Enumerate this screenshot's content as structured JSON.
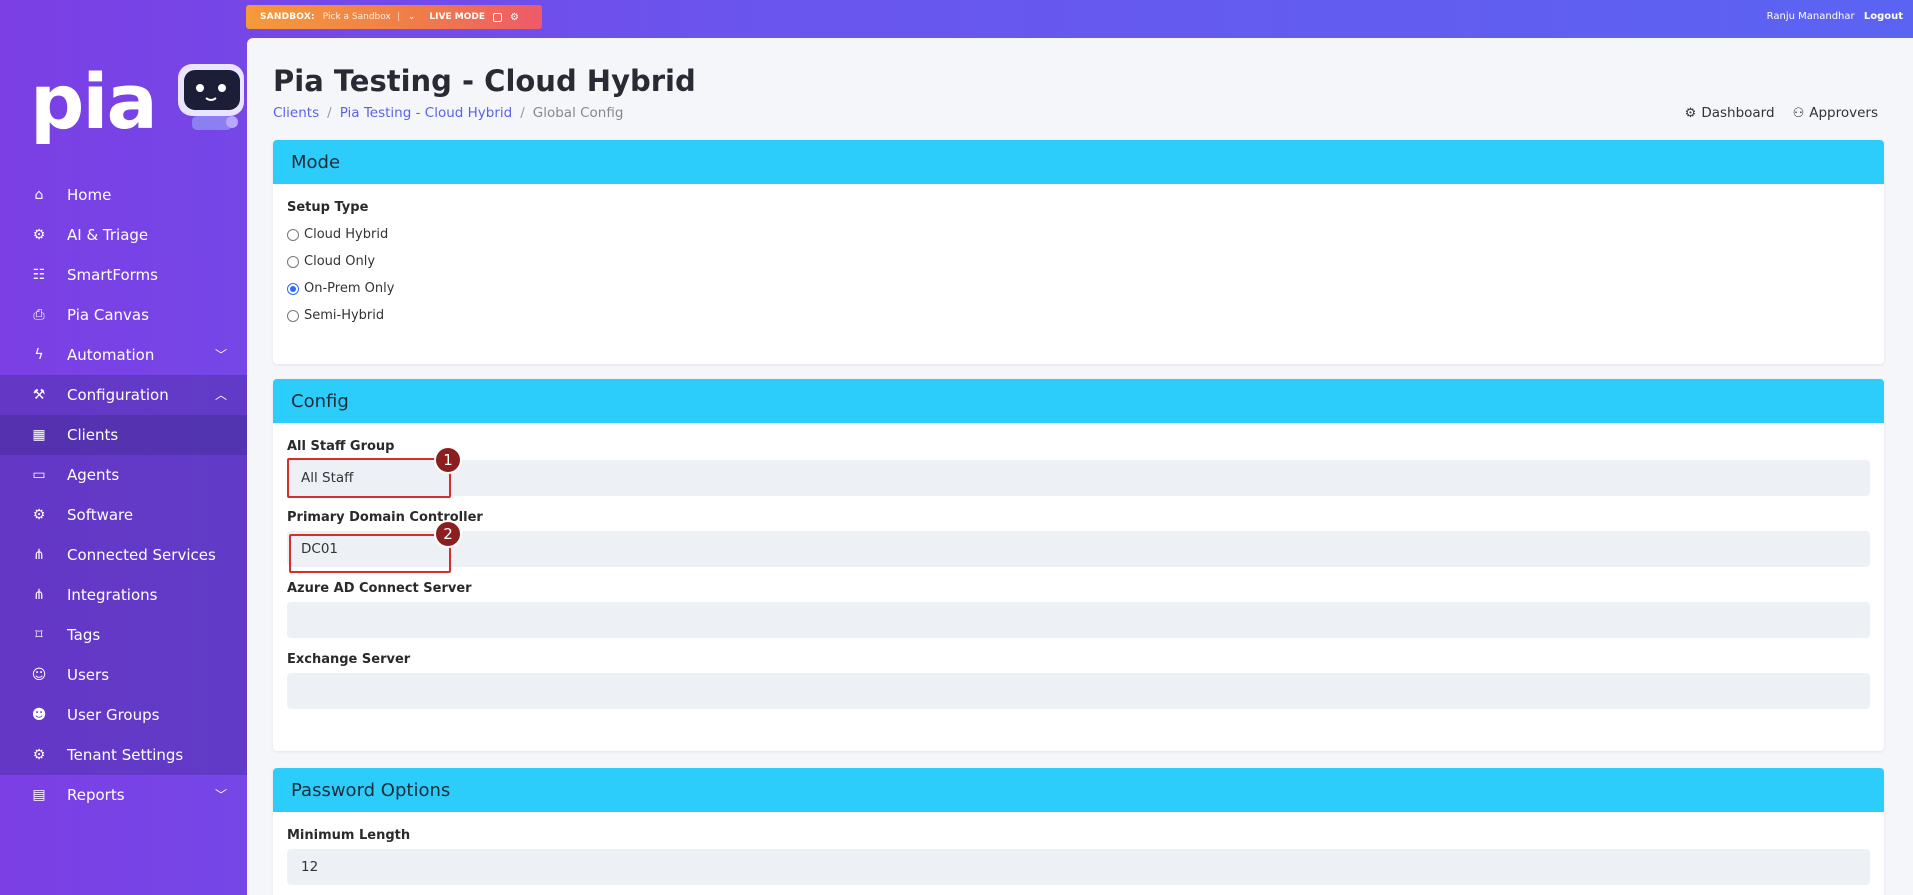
{
  "topbar": {
    "sandbox_label": "SANDBOX:",
    "sandbox_pick": "Pick a Sandbox",
    "sandbox_sep": "|",
    "live_mode": "LIVE MODE",
    "user_name": "Ranju Manandhar",
    "logout": "Logout"
  },
  "brand": {
    "logo_text": "pia"
  },
  "sidebar": {
    "items": [
      {
        "label": "Home",
        "icon": "home-icon",
        "glyph": "⌂"
      },
      {
        "label": "AI & Triage",
        "icon": "ai-triage-icon",
        "glyph": "⚙"
      },
      {
        "label": "SmartForms",
        "icon": "smartforms-icon",
        "glyph": "☷"
      },
      {
        "label": "Pia Canvas",
        "icon": "canvas-icon",
        "glyph": "⎙"
      },
      {
        "label": "Automation",
        "icon": "bolt-icon",
        "glyph": "ϟ"
      },
      {
        "label": "Configuration",
        "icon": "configuration-icon",
        "glyph": "⚒"
      },
      {
        "label": "Clients",
        "icon": "clients-icon",
        "glyph": "▦"
      },
      {
        "label": "Agents",
        "icon": "monitor-icon",
        "glyph": "▭"
      },
      {
        "label": "Software",
        "icon": "software-icon",
        "glyph": "⚙"
      },
      {
        "label": "Connected Services",
        "icon": "connected-services-icon",
        "glyph": "⋔"
      },
      {
        "label": "Integrations",
        "icon": "integrations-icon",
        "glyph": "⋔"
      },
      {
        "label": "Tags",
        "icon": "tag-icon",
        "glyph": "⌑"
      },
      {
        "label": "Users",
        "icon": "user-icon",
        "glyph": "☺"
      },
      {
        "label": "User Groups",
        "icon": "user-groups-icon",
        "glyph": "☻"
      },
      {
        "label": "Tenant Settings",
        "icon": "tenant-settings-icon",
        "glyph": "⚙"
      },
      {
        "label": "Reports",
        "icon": "reports-icon",
        "glyph": "▤"
      }
    ]
  },
  "page": {
    "title": "Pia Testing - Cloud Hybrid",
    "breadcrumb": [
      "Clients",
      "Pia Testing - Cloud Hybrid",
      "Global Config"
    ],
    "links": {
      "dashboard": "Dashboard",
      "approvers": "Approvers"
    }
  },
  "mode": {
    "header": "Mode",
    "setup_label": "Setup Type",
    "options": [
      "Cloud Hybrid",
      "Cloud Only",
      "On-Prem Only",
      "Semi-Hybrid"
    ],
    "selected": "On-Prem Only"
  },
  "config": {
    "header": "Config",
    "fields": [
      {
        "label": "All Staff Group",
        "value": "All Staff"
      },
      {
        "label": "Primary Domain Controller",
        "value": "DC01"
      },
      {
        "label": "Azure AD Connect Server",
        "value": ""
      },
      {
        "label": "Exchange Server",
        "value": ""
      }
    ]
  },
  "password": {
    "header": "Password Options",
    "fields": [
      {
        "label": "Minimum Length",
        "value": "12"
      }
    ]
  },
  "annotations": {
    "one": "1",
    "two": "2"
  },
  "colors": {
    "accent": "#2dcdfb",
    "sidebar": "#7b3fe4",
    "annotation": "#d62d2d"
  }
}
